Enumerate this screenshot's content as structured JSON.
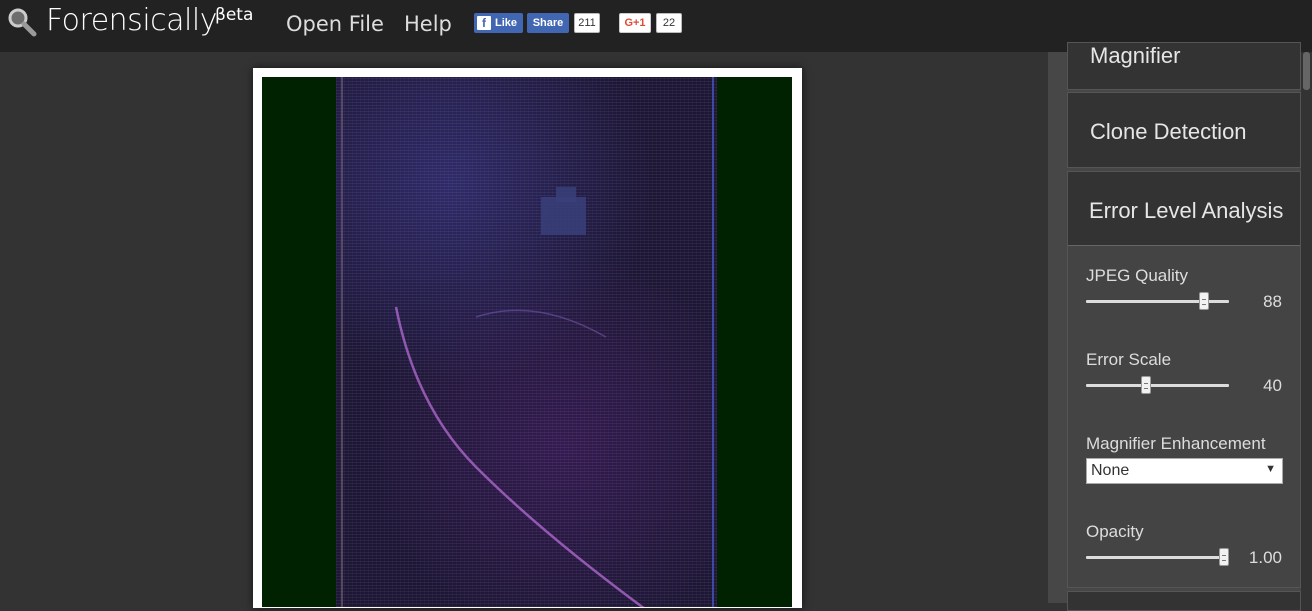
{
  "header": {
    "title": "Forensically",
    "beta": "βeta",
    "nav": {
      "open_file": "Open File",
      "help": "Help"
    },
    "social": {
      "fb_like": "Like",
      "fb_share": "Share",
      "fb_count": "211",
      "gplus": "G+1",
      "gplus_count": "22"
    }
  },
  "sidebar": {
    "magnifier": "Magnifier",
    "clone_detection": "Clone Detection",
    "ela": {
      "title": "Error Level Analysis",
      "jpeg_quality": {
        "label": "JPEG Quality",
        "value": "88",
        "fraction": 0.85
      },
      "error_scale": {
        "label": "Error Scale",
        "value": "40",
        "fraction": 0.41
      },
      "magnifier_enhancement": {
        "label": "Magnifier Enhancement",
        "selected": "None"
      },
      "opacity": {
        "label": "Opacity",
        "value": "1.00",
        "fraction": 1.0
      }
    }
  },
  "colors": {
    "topbar": "#222222",
    "accent_fb": "#4267b2",
    "gplus_red": "#dd4b39",
    "image_bg": "#002200"
  }
}
